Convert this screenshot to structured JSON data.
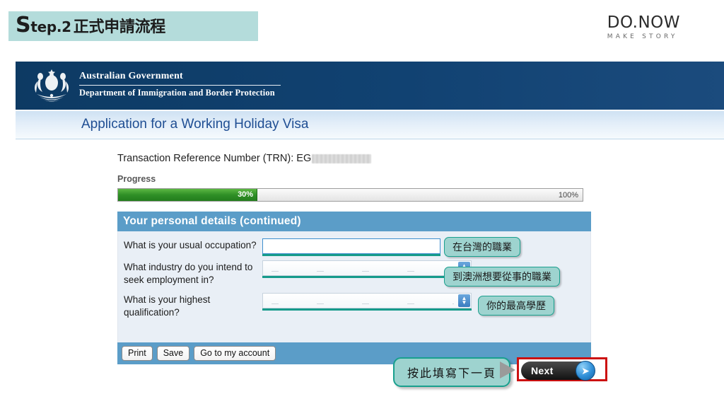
{
  "step_banner": {
    "initial": "S",
    "rest": "tep.2",
    "chinese": "正式申請流程"
  },
  "brand": {
    "name": "DO.NOW",
    "tagline": "MAKE STORY"
  },
  "gov_banner": {
    "line1": "Australian Government",
    "line2": "Department of Immigration and Border Protection",
    "crest_icon": "australian-coat-of-arms-icon"
  },
  "page_title": "Application for a Working Holiday Visa",
  "trn": {
    "label": "Transaction Reference Number (TRN): ",
    "value_prefix": "EG",
    "redacted": true
  },
  "progress": {
    "label": "Progress",
    "current_percent": "30%",
    "end_percent": "100%",
    "fill_color": "#2f8f26",
    "value": 30
  },
  "form": {
    "section_title": "Your personal details (continued)",
    "fields": [
      {
        "label": "What is your usual occupation?",
        "type": "text",
        "value": "",
        "callout": "在台灣的職業"
      },
      {
        "label": "What industry do you intend to seek employment in?",
        "type": "select",
        "value": "",
        "callout": "到澳洲想要從事的職業"
      },
      {
        "label": "What is your highest qualification?",
        "type": "select",
        "value": "",
        "callout": "你的最高學歷"
      }
    ],
    "buttons": [
      "Print",
      "Save",
      "Go to my account"
    ]
  },
  "footer": {
    "next_callout": "按此填寫下一頁",
    "next_label": "Next",
    "next_arrow_icon": "circle-arrow-right-icon",
    "pointer_icon": "triangle-right-icon",
    "highlight_color": "#cc1111"
  },
  "colors": {
    "banner_navy": "#114272",
    "panel_blue": "#5b9dc8",
    "callout_teal": "#9ed3cf",
    "step_banner": "#b4dcdb"
  }
}
